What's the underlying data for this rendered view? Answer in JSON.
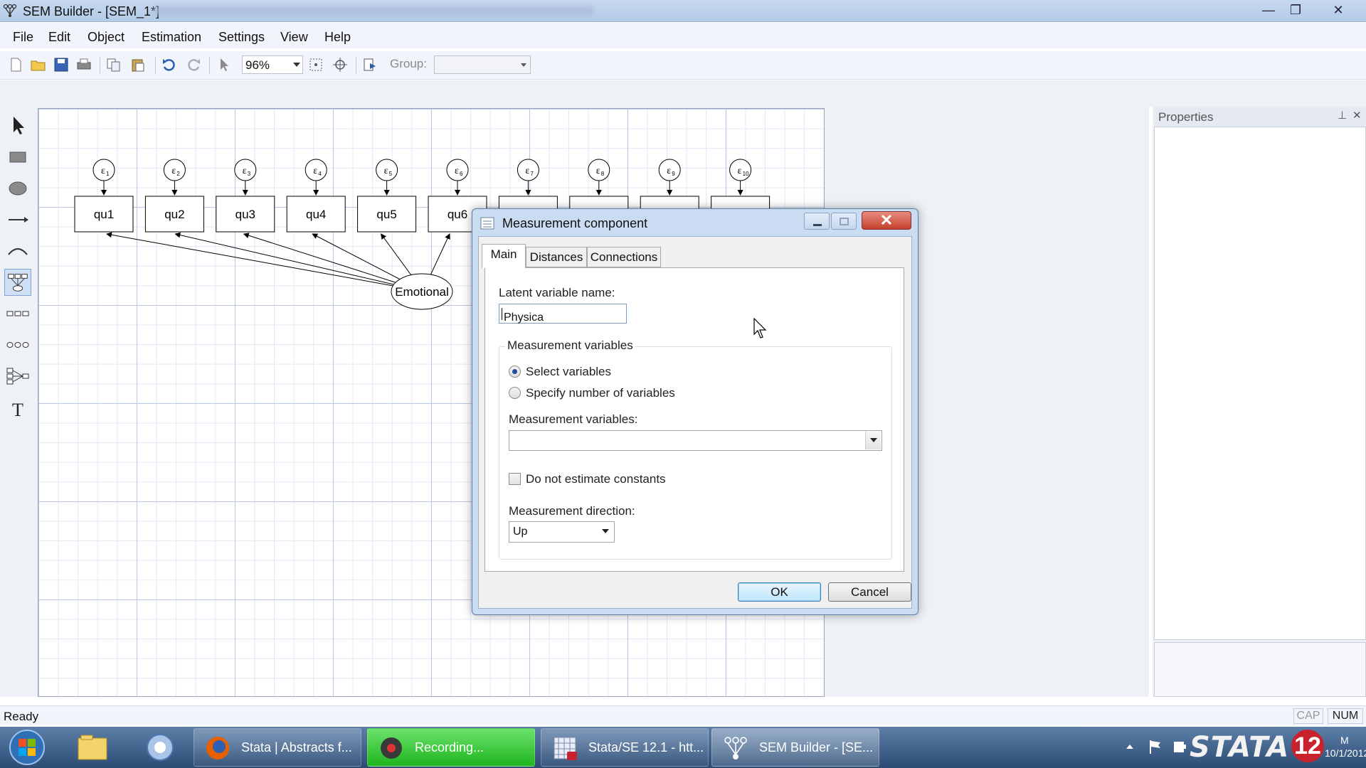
{
  "window": {
    "title": "SEM Builder - [SEM_1*]",
    "controls": {
      "minimize": "—",
      "maximize": "❐",
      "close": "✕"
    }
  },
  "menu": [
    "File",
    "Edit",
    "Object",
    "Estimation",
    "Settings",
    "View",
    "Help"
  ],
  "toolbar": {
    "zoom": "96%",
    "group_label": "Group:",
    "group_value": ""
  },
  "palette_tools": [
    "select-tool",
    "observed-variable-tool",
    "latent-variable-tool",
    "path-tool",
    "covariance-tool",
    "measurement-component-tool",
    "observed-set-tool",
    "latent-set-tool",
    "regression-component-tool",
    "text-tool"
  ],
  "diagram": {
    "observed": [
      "qu1",
      "qu2",
      "qu3",
      "qu4",
      "qu5",
      "qu6"
    ],
    "error_label": "ε",
    "error_subscripts": [
      "1",
      "2",
      "3",
      "4",
      "5",
      "6",
      "7",
      "8",
      "9",
      "10"
    ],
    "latent": "Emotional"
  },
  "properties": {
    "title": "Properties",
    "pin": "⊥",
    "close": "✕"
  },
  "status": {
    "text": "Ready",
    "cap": "CAP",
    "num": "NUM"
  },
  "taskbar": {
    "tasks": [
      {
        "label": "Stata | Abstracts f..."
      },
      {
        "label": "Recording..."
      },
      {
        "label": "Stata/SE 12.1 - htt..."
      },
      {
        "label": "SEM Builder - [SE..."
      }
    ],
    "brand": "STATA",
    "brand_version": "12",
    "clock_time": "M",
    "clock_date": "10/1/2012",
    "accent": "#c8232c"
  },
  "dialog": {
    "title": "Measurement component",
    "tabs": [
      "Main",
      "Distances",
      "Connections"
    ],
    "latent_label": "Latent variable name:",
    "latent_value": "Physica",
    "group_title": "Measurement variables",
    "radio_select": "Select variables",
    "radio_specify": "Specify number of variables",
    "mv_label": "Measurement variables:",
    "mv_value": "",
    "no_constants": "Do not estimate constants",
    "direction_label": "Measurement direction:",
    "direction_value": "Up",
    "ok": "OK",
    "cancel": "Cancel"
  }
}
